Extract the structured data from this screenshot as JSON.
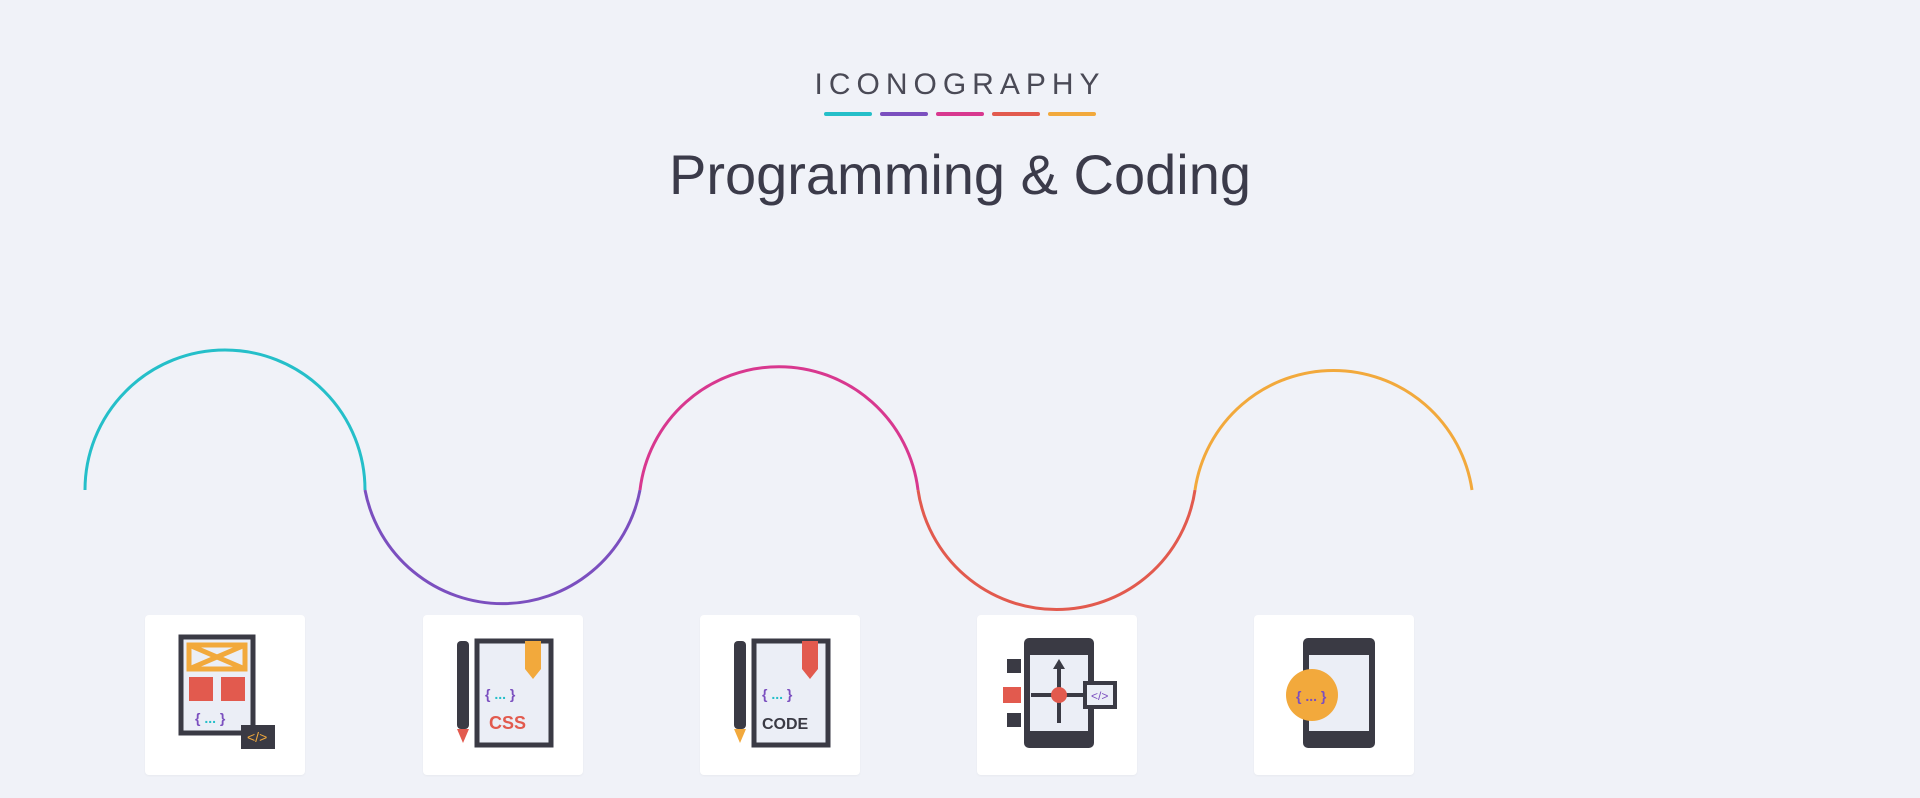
{
  "header": {
    "brand": "ICONOGRAPHY",
    "title": "Programming & Coding"
  },
  "underline_colors": [
    "#25bfc9",
    "#7b4fbf",
    "#d8388f",
    "#e25a4e",
    "#f2a93c"
  ],
  "icons": [
    {
      "name": "wireframe-code-icon",
      "label": "{ ... }",
      "caption": ""
    },
    {
      "name": "css-document-icon",
      "label": "{ ... }",
      "caption": "CSS"
    },
    {
      "name": "code-document-icon",
      "label": "{ ... }",
      "caption": "CODE"
    },
    {
      "name": "app-development-icon",
      "label": "",
      "caption": ""
    },
    {
      "name": "mobile-code-icon",
      "label": "{ ... }",
      "caption": ""
    }
  ],
  "palette": {
    "teal": "#25bfc9",
    "purple": "#7b4fbf",
    "pink": "#d8388f",
    "red": "#e25a4e",
    "orange": "#f2a93c",
    "dark": "#3a3a44",
    "bg": "#f0f2f8"
  }
}
